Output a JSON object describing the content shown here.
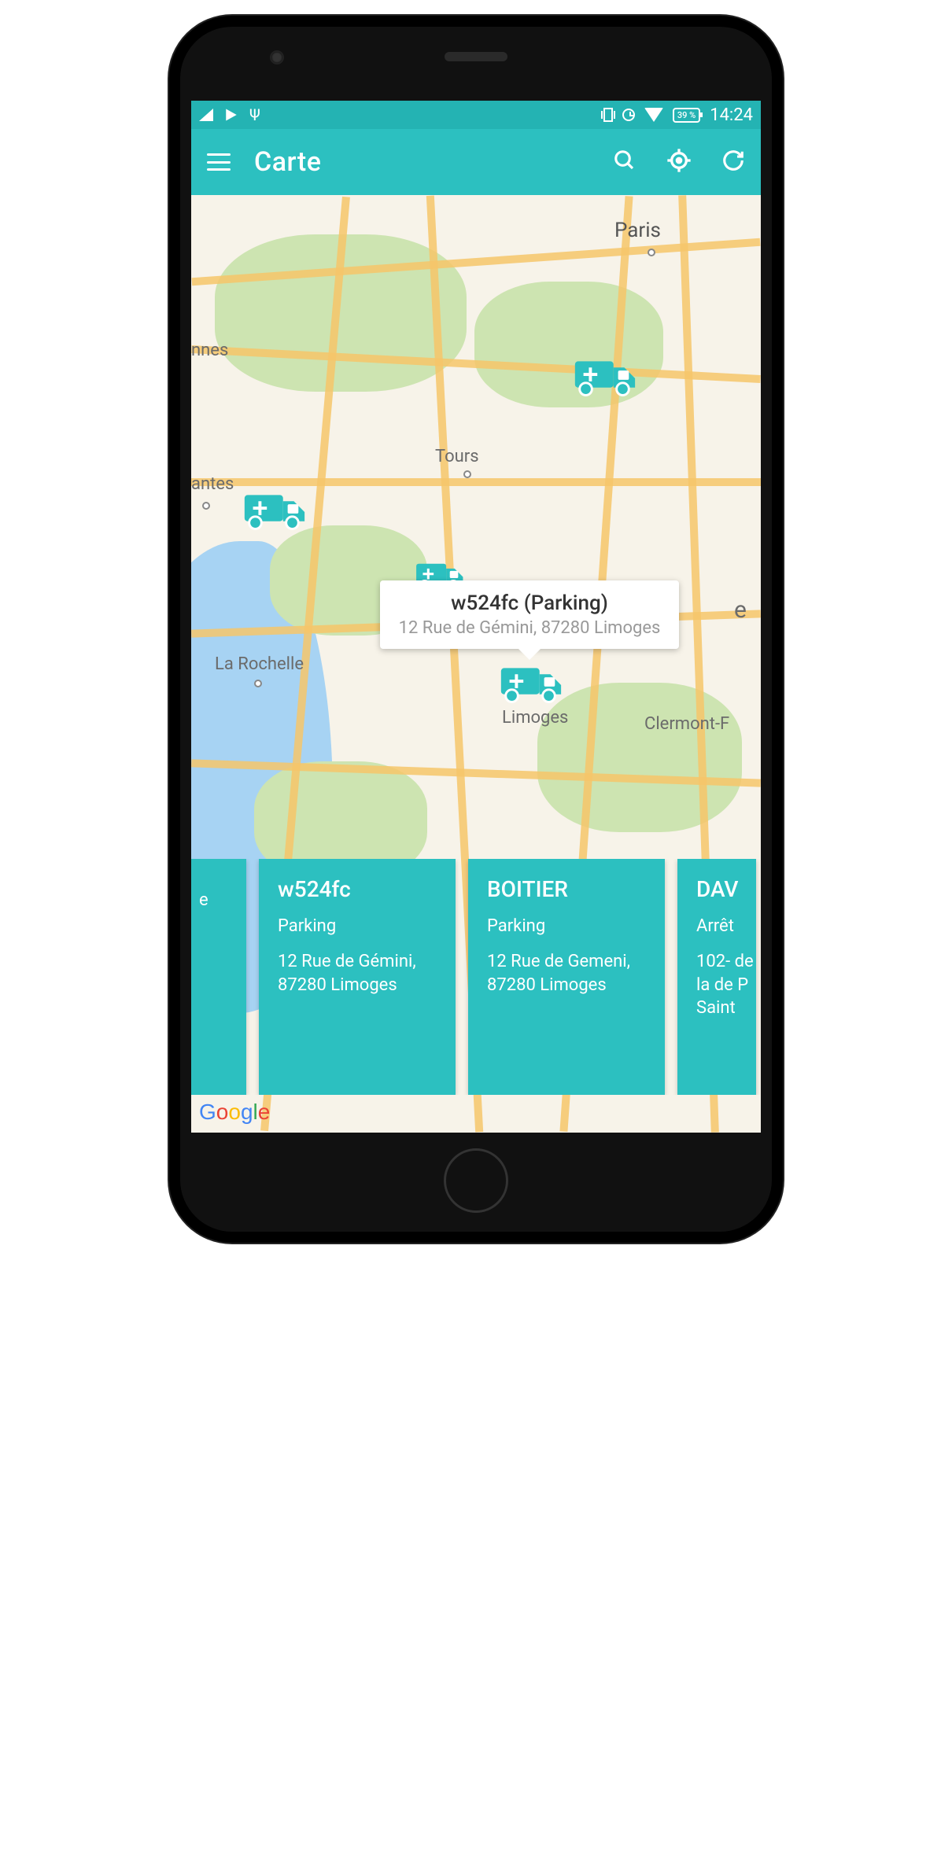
{
  "statusbar": {
    "battery": "39 %",
    "time": "14:24"
  },
  "appbar": {
    "title": "Carte"
  },
  "map": {
    "cities": {
      "paris": "Paris",
      "tours": "Tours",
      "nnes": "nnes",
      "antes": "antes",
      "larochelle": "La Rochelle",
      "limoges": "Limoges",
      "clermont": "Clermont-F",
      "e": "e"
    },
    "infowindow": {
      "title": "w524fc  (Parking)",
      "subtitle": "12 Rue de Gémini, 87280 Limoges"
    },
    "attribution": "Google"
  },
  "cards": [
    {
      "title": "",
      "status": "e",
      "address": ""
    },
    {
      "title": "w524fc",
      "status": "Parking",
      "address": "12 Rue de Gémini, 87280 Limoges"
    },
    {
      "title": "BOITIER",
      "status": "Parking",
      "address": "12 Rue de Gemeni, 87280 Limoges"
    },
    {
      "title": "DAV",
      "status": "Arrêt",
      "address": "102- de la de P Saint"
    }
  ]
}
